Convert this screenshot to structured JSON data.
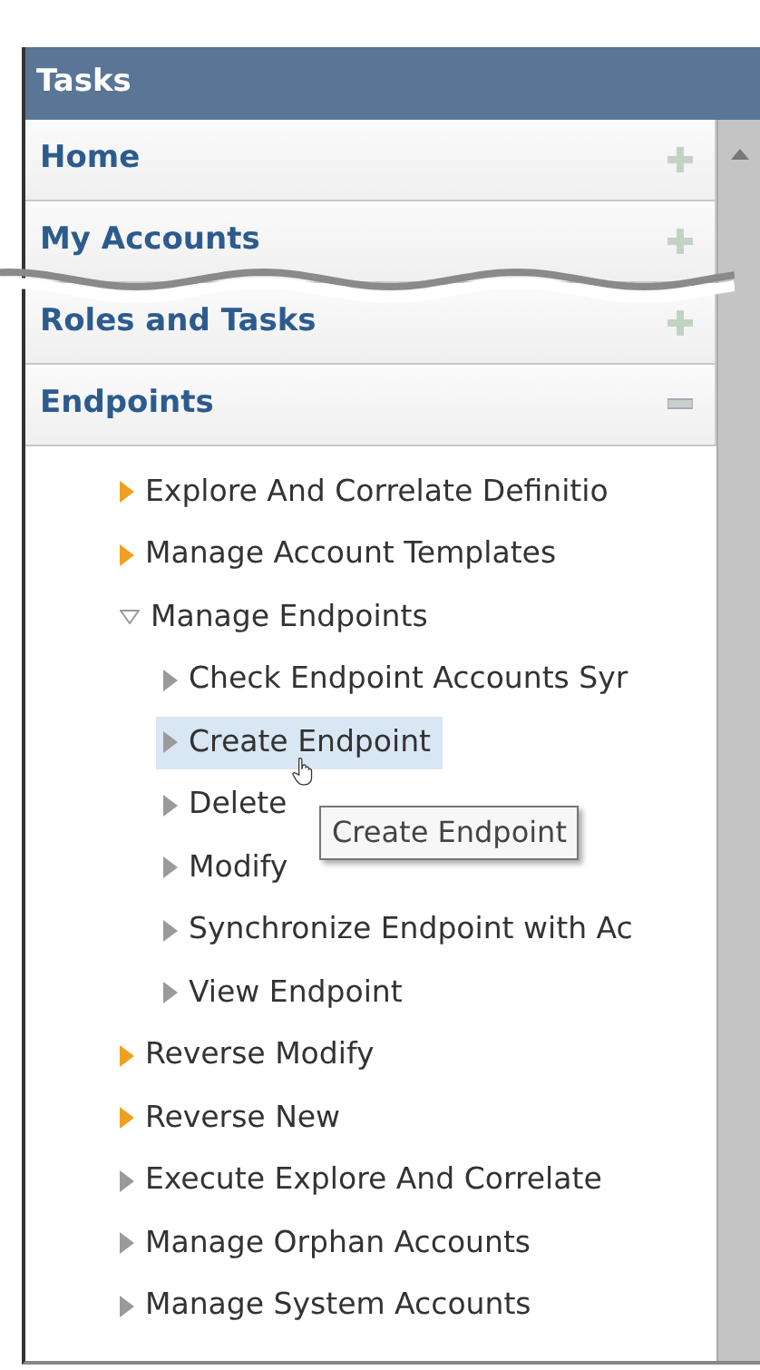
{
  "panel": {
    "title": "Tasks"
  },
  "sections": [
    {
      "label": "Home",
      "expanded": false
    },
    {
      "label": "My Accounts",
      "expanded": false
    },
    {
      "label": "Roles and Tasks",
      "expanded": false
    },
    {
      "label": "Endpoints",
      "expanded": true
    }
  ],
  "tree": [
    {
      "label": "Explore And Correlate Definitio",
      "kind": "task",
      "expanded": false,
      "selected": false
    },
    {
      "label": "Manage Account Templates",
      "kind": "task",
      "expanded": false,
      "selected": false
    },
    {
      "label": "Manage Endpoints",
      "kind": "group",
      "expanded": true,
      "selected": false,
      "children": [
        {
          "label": "Check Endpoint Accounts Syr",
          "kind": "group",
          "expanded": false,
          "selected": false
        },
        {
          "label": "Create Endpoint",
          "kind": "group",
          "expanded": false,
          "selected": true
        },
        {
          "label": "Delete",
          "kind": "group",
          "expanded": false,
          "selected": false
        },
        {
          "label": "Modify",
          "kind": "group",
          "expanded": false,
          "selected": false
        },
        {
          "label": "Synchronize Endpoint with Ac",
          "kind": "group",
          "expanded": false,
          "selected": false
        },
        {
          "label": "View Endpoint",
          "kind": "group",
          "expanded": false,
          "selected": false
        }
      ]
    },
    {
      "label": "Reverse Modify",
      "kind": "task",
      "expanded": false,
      "selected": false
    },
    {
      "label": "Reverse New",
      "kind": "task",
      "expanded": false,
      "selected": false
    },
    {
      "label": "Execute Explore And Correlate",
      "kind": "group",
      "expanded": false,
      "selected": false
    },
    {
      "label": "Manage Orphan Accounts",
      "kind": "group",
      "expanded": false,
      "selected": false
    },
    {
      "label": "Manage System Accounts",
      "kind": "group",
      "expanded": false,
      "selected": false
    }
  ],
  "tooltip": {
    "text": "Create Endpoint"
  }
}
